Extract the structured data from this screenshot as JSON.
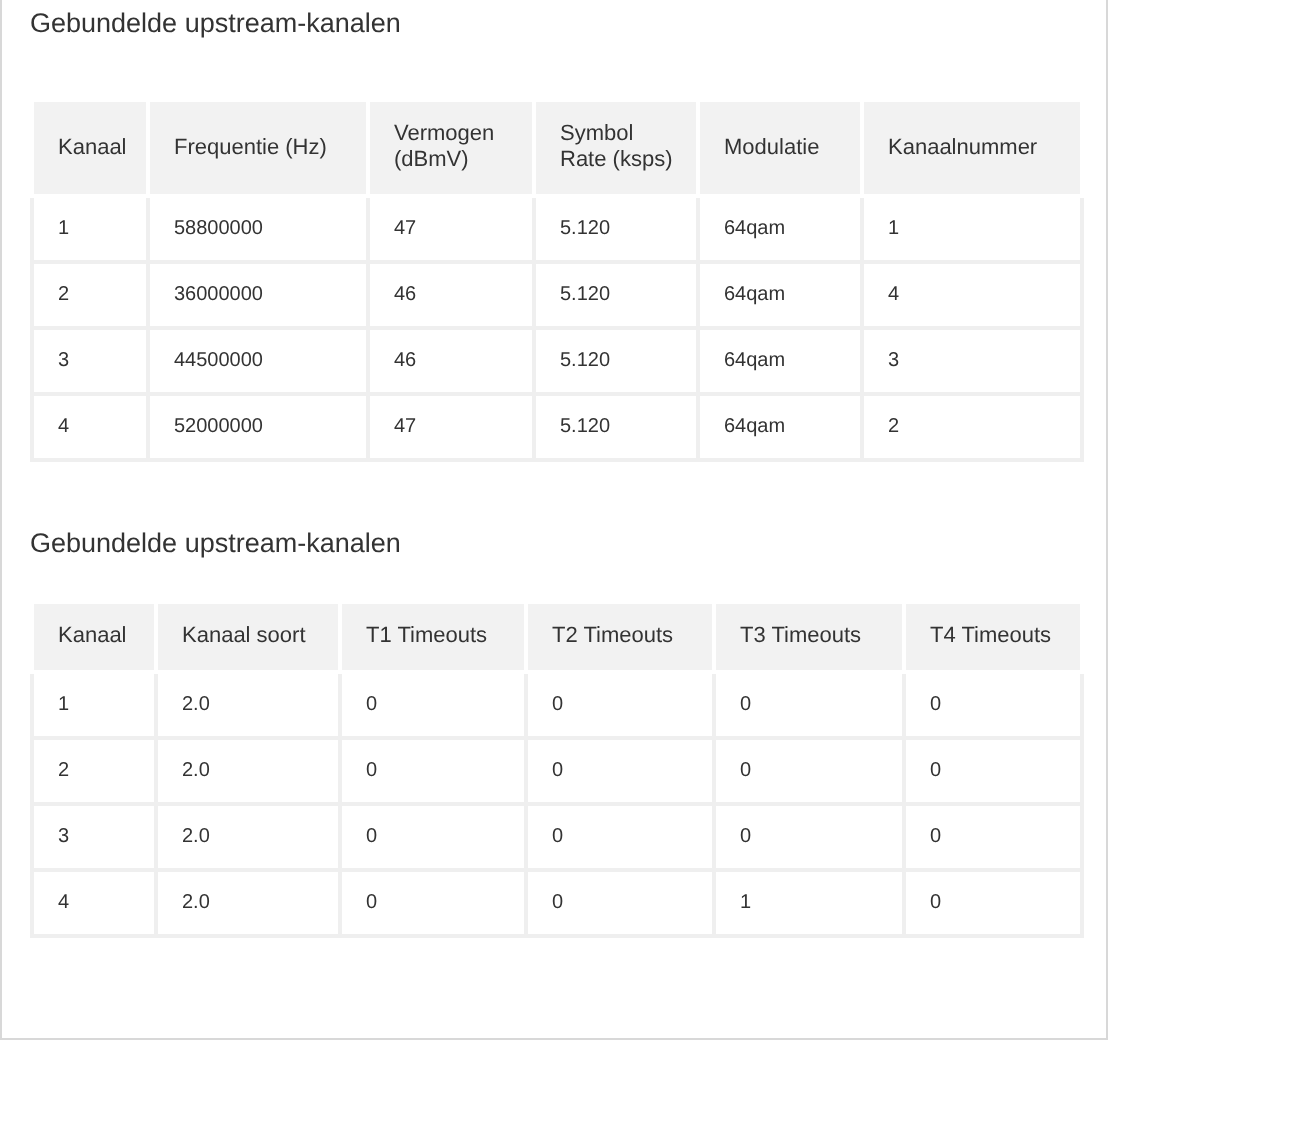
{
  "sections": [
    {
      "title": "Gebundelde upstream-kanalen",
      "table": {
        "columns": [
          "Kanaal",
          "Frequentie (Hz)",
          "Vermogen (dBmV)",
          "Symbol Rate (ksps)",
          "Modulatie",
          "Kanaalnummer"
        ],
        "rows": [
          [
            "1",
            "58800000",
            "47",
            "5.120",
            "64qam",
            "1"
          ],
          [
            "2",
            "36000000",
            "46",
            "5.120",
            "64qam",
            "4"
          ],
          [
            "3",
            "44500000",
            "46",
            "5.120",
            "64qam",
            "3"
          ],
          [
            "4",
            "52000000",
            "47",
            "5.120",
            "64qam",
            "2"
          ]
        ]
      }
    },
    {
      "title": "Gebundelde upstream-kanalen",
      "table": {
        "columns": [
          "Kanaal",
          "Kanaal soort",
          "T1 Timeouts",
          "T2 Timeouts",
          "T3 Timeouts",
          "T4 Timeouts"
        ],
        "rows": [
          [
            "1",
            "2.0",
            "0",
            "0",
            "0",
            "0"
          ],
          [
            "2",
            "2.0",
            "0",
            "0",
            "0",
            "0"
          ],
          [
            "3",
            "2.0",
            "0",
            "0",
            "0",
            "0"
          ],
          [
            "4",
            "2.0",
            "0",
            "0",
            "1",
            "0"
          ]
        ]
      }
    }
  ]
}
